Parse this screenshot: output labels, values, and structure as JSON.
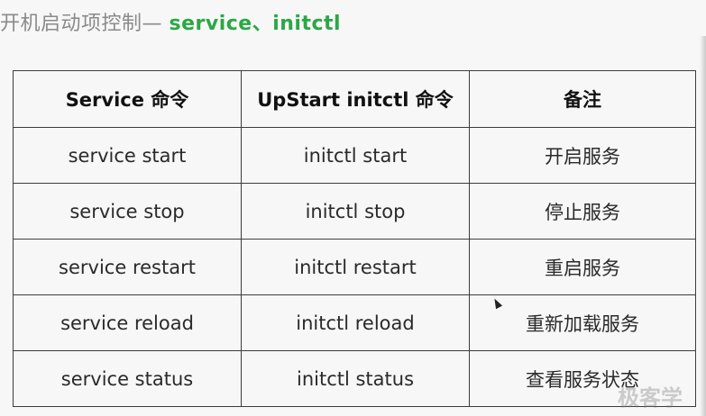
{
  "title": {
    "prefix": "开机启动项控制— ",
    "highlight": "service、initctl"
  },
  "table": {
    "headers": [
      "Service 命令",
      "UpStart initctl 命令",
      "备注"
    ],
    "rows": [
      [
        "service start",
        "initctl start",
        "开启服务"
      ],
      [
        "service stop",
        "initctl stop",
        "停止服务"
      ],
      [
        "service restart",
        "initctl restart",
        "重启服务"
      ],
      [
        "service reload",
        "initctl reload",
        "重新加载服务"
      ],
      [
        "service status",
        "initctl status",
        "查看服务状态"
      ]
    ]
  },
  "watermark": {
    "text": "极客学"
  }
}
